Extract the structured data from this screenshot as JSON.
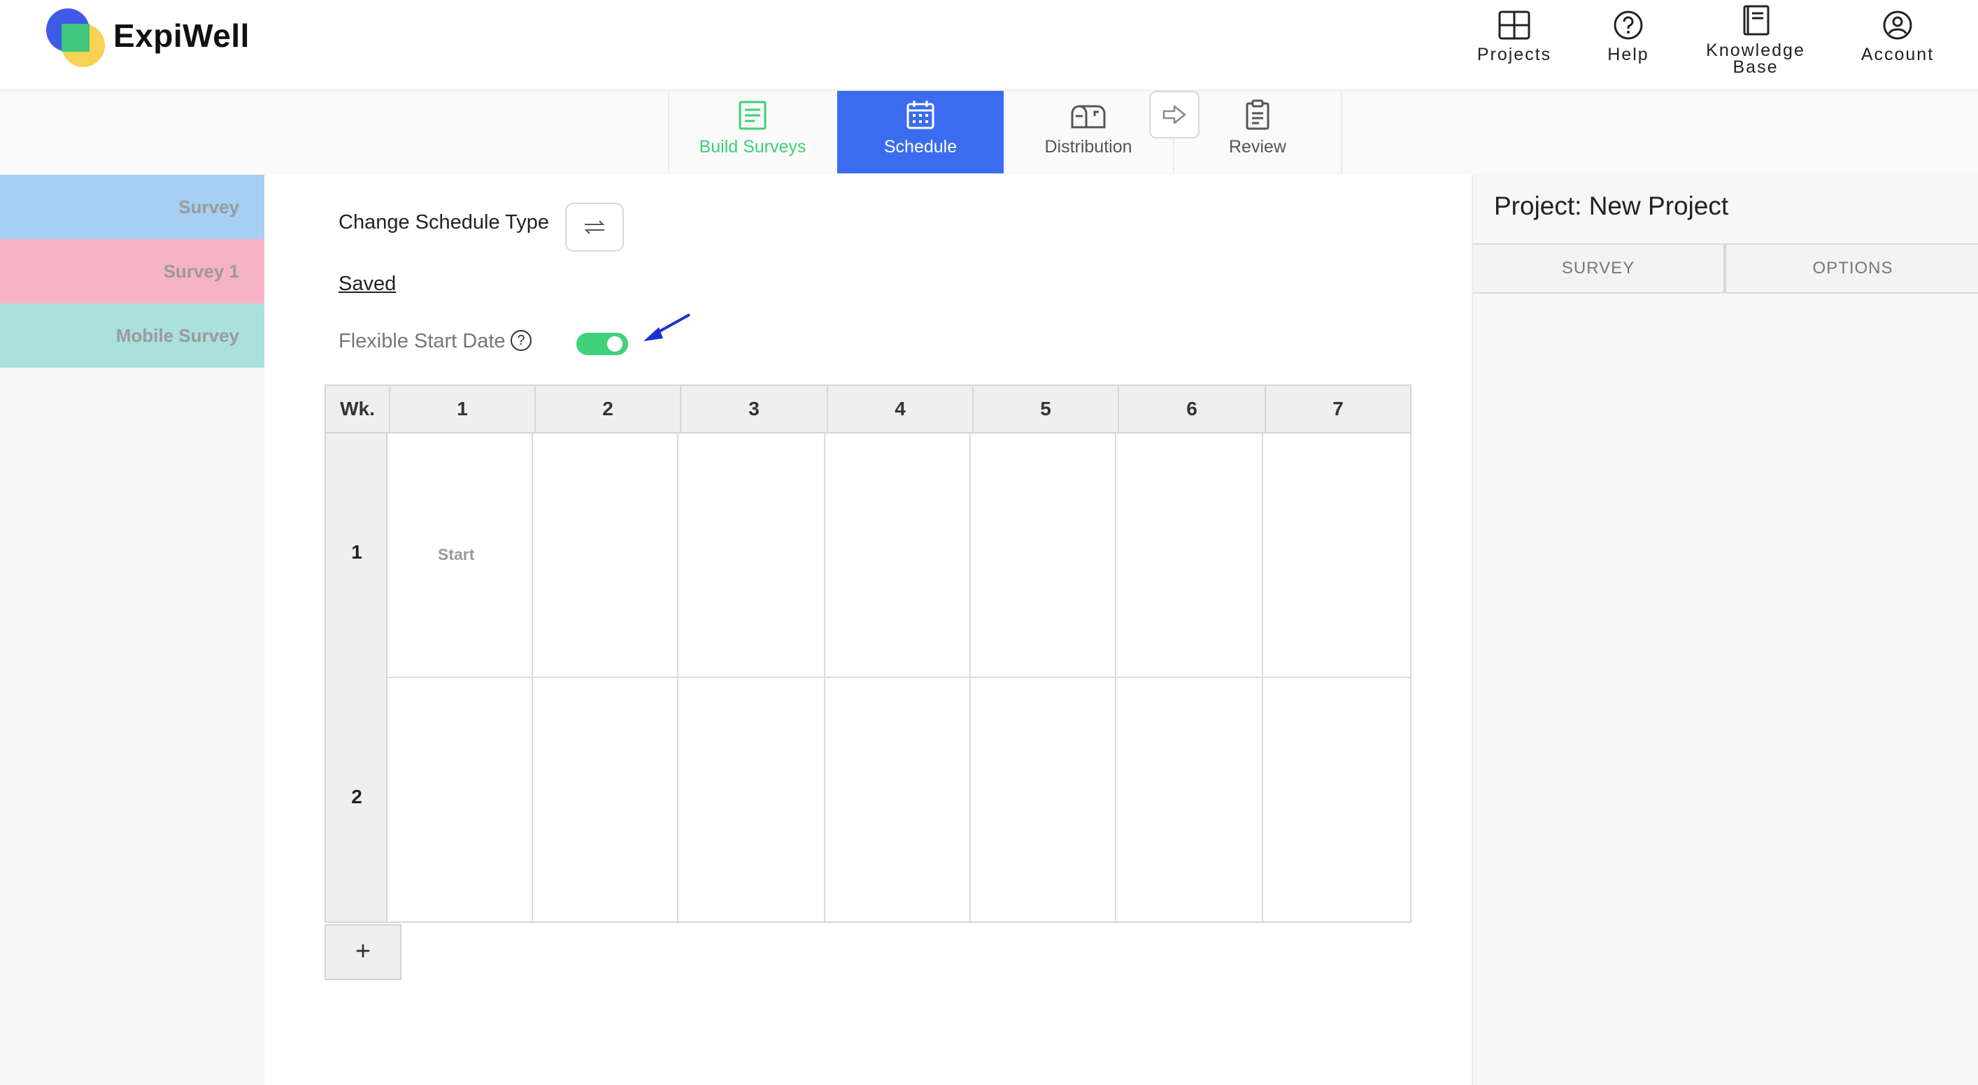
{
  "app": {
    "brand": "ExpiWell"
  },
  "topnav": {
    "projects": "Projects",
    "help": "Help",
    "knowledge_line1": "Knowledge",
    "knowledge_line2": "Base",
    "account": "Account"
  },
  "tabs": {
    "build": "Build Surveys",
    "schedule": "Schedule",
    "distribution": "Distribution",
    "review": "Review"
  },
  "sidebar": {
    "items": [
      {
        "label": "Survey",
        "color": "#a6cff2"
      },
      {
        "label": "Survey 1",
        "color": "#f6b3c6"
      },
      {
        "label": "Mobile Survey",
        "color": "#ace0dc"
      }
    ]
  },
  "schedule": {
    "change_type_label": "Change Schedule Type",
    "saved_label": "Saved",
    "flexible_label": "Flexible Start Date",
    "flexible_enabled": true,
    "help_glyph": "?",
    "grid": {
      "week_header": "Wk.",
      "day_headers": [
        "1",
        "2",
        "3",
        "4",
        "5",
        "6",
        "7"
      ],
      "weeks": [
        "1",
        "2"
      ],
      "start_label": "Start"
    },
    "add_week_label": "+"
  },
  "right_panel": {
    "title": "Project: New Project",
    "tabs": [
      "SURVEY",
      "OPTIONS"
    ]
  },
  "colors": {
    "accent_blue": "#3b6cf0",
    "accent_green": "#3fcf77",
    "toggle_on": "#3fd27a",
    "annotation_arrow": "#1f2fd6"
  }
}
